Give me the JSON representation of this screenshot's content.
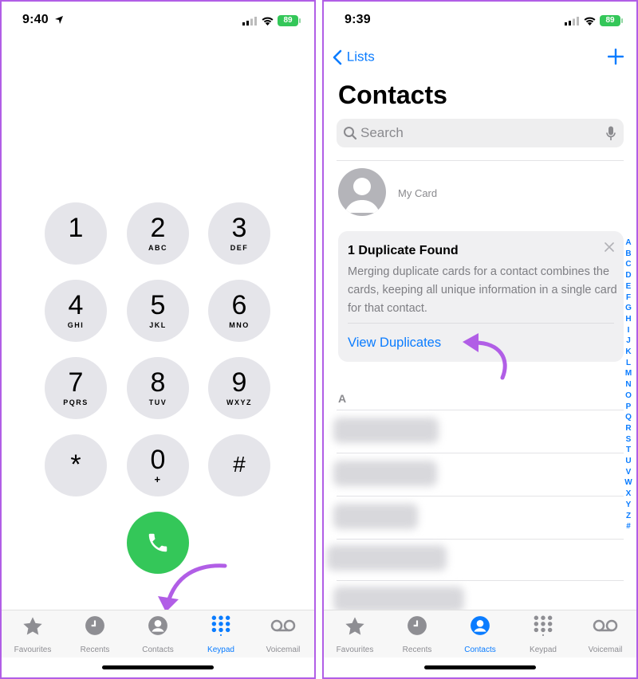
{
  "left_screen": {
    "status": {
      "time": "9:40",
      "battery": "89"
    },
    "keypad": [
      {
        "digit": "1",
        "letters": ""
      },
      {
        "digit": "2",
        "letters": "ABC"
      },
      {
        "digit": "3",
        "letters": "DEF"
      },
      {
        "digit": "4",
        "letters": "GHI"
      },
      {
        "digit": "5",
        "letters": "JKL"
      },
      {
        "digit": "6",
        "letters": "MNO"
      },
      {
        "digit": "7",
        "letters": "PQRS"
      },
      {
        "digit": "8",
        "letters": "TUV"
      },
      {
        "digit": "9",
        "letters": "WXYZ"
      },
      {
        "digit": "*",
        "letters": ""
      },
      {
        "digit": "0",
        "letters": "+"
      },
      {
        "digit": "#",
        "letters": ""
      }
    ],
    "tabs": [
      {
        "label": "Favourites",
        "icon": "star-icon",
        "active": false
      },
      {
        "label": "Recents",
        "icon": "clock-icon",
        "active": false
      },
      {
        "label": "Contacts",
        "icon": "person-circle-icon",
        "active": false
      },
      {
        "label": "Keypad",
        "icon": "keypad-icon",
        "active": true
      },
      {
        "label": "Voicemail",
        "icon": "voicemail-icon",
        "active": false
      }
    ]
  },
  "right_screen": {
    "status": {
      "time": "9:39",
      "battery": "89"
    },
    "nav": {
      "back_label": "Lists"
    },
    "title": "Contacts",
    "search": {
      "placeholder": "Search"
    },
    "my_card": {
      "label": "My Card"
    },
    "duplicate_card": {
      "title": "1 Duplicate Found",
      "body": "Merging duplicate cards for a contact combines the cards, keeping all unique information in a single card for that contact.",
      "link": "View Duplicates"
    },
    "section_header": "A",
    "index_letters": [
      "A",
      "B",
      "C",
      "D",
      "E",
      "F",
      "G",
      "H",
      "I",
      "J",
      "K",
      "L",
      "M",
      "N",
      "O",
      "P",
      "Q",
      "R",
      "S",
      "T",
      "U",
      "V",
      "W",
      "X",
      "Y",
      "Z",
      "#"
    ],
    "tabs": [
      {
        "label": "Favourites",
        "icon": "star-icon",
        "active": false
      },
      {
        "label": "Recents",
        "icon": "clock-icon",
        "active": false
      },
      {
        "label": "Contacts",
        "icon": "person-circle-icon",
        "active": true
      },
      {
        "label": "Keypad",
        "icon": "keypad-icon",
        "active": false
      },
      {
        "label": "Voicemail",
        "icon": "voicemail-icon",
        "active": false
      }
    ]
  },
  "colors": {
    "accent": "#0a7cff",
    "call_green": "#34c759",
    "annotation_purple": "#b15ee6"
  }
}
